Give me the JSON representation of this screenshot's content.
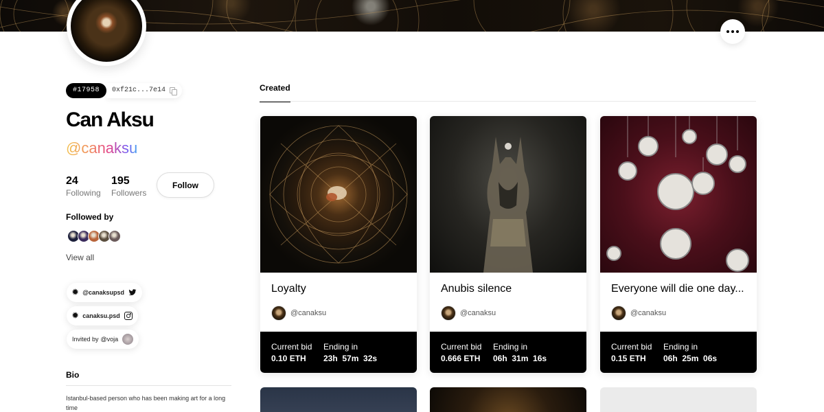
{
  "profile": {
    "id_badge": "#17958",
    "address": "0xf21c...7e14",
    "name": "Can Aksu",
    "handle": "@canaksu",
    "following_count": "24",
    "following_label": "Following",
    "followers_count": "195",
    "followers_label": "Followers",
    "follow_button": "Follow",
    "followed_by_title": "Followed by",
    "followed_by_avatars": [
      "#1c1f3a",
      "#3a2b5c",
      "#b8643a",
      "#5a4e3e",
      "#6a5a5a"
    ],
    "view_all": "View all"
  },
  "links": {
    "twitter": "@canaksupsd",
    "instagram": "canaksu.psd",
    "invited_prefix": "Invited by",
    "invited_by": "@voja"
  },
  "bio": {
    "title": "Bio",
    "text": "Istanbul-based person who has been making art for a long time"
  },
  "tabs": {
    "created": "Created"
  },
  "cards": [
    {
      "title": "Loyalty",
      "creator": "@canaksu",
      "bid_label": "Current bid",
      "bid_value": "0.10 ETH",
      "ending_label": "Ending in",
      "ending_value": "23h  57m  32s"
    },
    {
      "title": "Anubis silence",
      "creator": "@canaksu",
      "bid_label": "Current bid",
      "bid_value": "0.666 ETH",
      "ending_label": "Ending in",
      "ending_value": "06h  31m  16s"
    },
    {
      "title": "Everyone will die one day...",
      "creator": "@canaksu",
      "bid_label": "Current bid",
      "bid_value": "0.15 ETH",
      "ending_label": "Ending in",
      "ending_value": "06h  25m  06s"
    }
  ],
  "colors": {
    "accent": "#000000",
    "handle_gradient": [
      "#f2c14e",
      "#f08a5d",
      "#e3448b",
      "#7b5cf0",
      "#4aa3f0"
    ]
  }
}
